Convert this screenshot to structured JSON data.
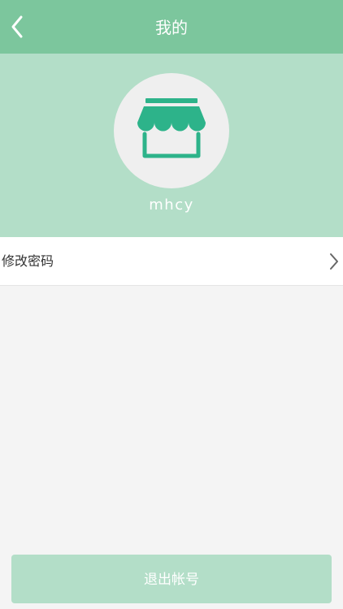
{
  "header": {
    "title": "我的",
    "back_icon": "chevron-left-icon",
    "background": "#7cc69d"
  },
  "profile": {
    "avatar_icon": "storefront-icon",
    "username": "mhcy",
    "background": "#b3dec8",
    "icon_color": "#2db38a"
  },
  "menu": {
    "items": [
      {
        "label": "修改密码",
        "icon": "chevron-right-icon"
      }
    ]
  },
  "footer": {
    "logout_label": "退出帐号",
    "button_color": "#b3dec8"
  }
}
